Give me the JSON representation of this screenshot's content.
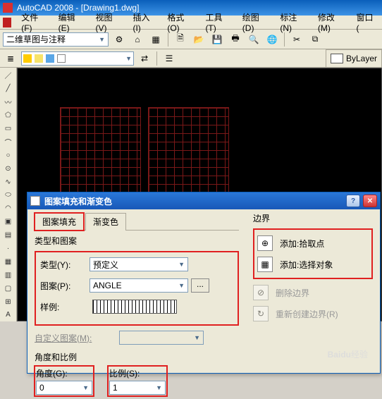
{
  "window": {
    "title": "AutoCAD 2008 - [Drawing1.dwg]"
  },
  "menus": [
    "文件(F)",
    "编辑(E)",
    "视图(V)",
    "插入(I)",
    "格式(O)",
    "工具(T)",
    "绘图(D)",
    "标注(N)",
    "修改(M)",
    "窗口("
  ],
  "toolbar": {
    "workspace_combo": "二维草图与注释",
    "bylayer": "ByLayer"
  },
  "dialog": {
    "title": "图案填充和渐变色",
    "tabs": {
      "t1": "图案填充",
      "t2": "渐变色"
    },
    "left": {
      "group1_label": "类型和图案",
      "type_label": "类型(Y):",
      "type_value": "预定义",
      "pattern_label": "图案(P):",
      "pattern_value": "ANGLE",
      "swatch_label": "样例:",
      "custom_label": "自定义图案(M):",
      "group2_label": "角度和比例",
      "angle_label": "角度(G):",
      "angle_value": "0",
      "scale_label": "比例(S):",
      "scale_value": "1"
    },
    "right": {
      "header": "边界",
      "add_pick": "添加:拾取点",
      "add_sel": "添加:选择对象",
      "del_b": "删除边界",
      "recreate": "重新创建边界(R)"
    }
  },
  "watermark": {
    "brand": "Baidu",
    "sub": "经验"
  }
}
